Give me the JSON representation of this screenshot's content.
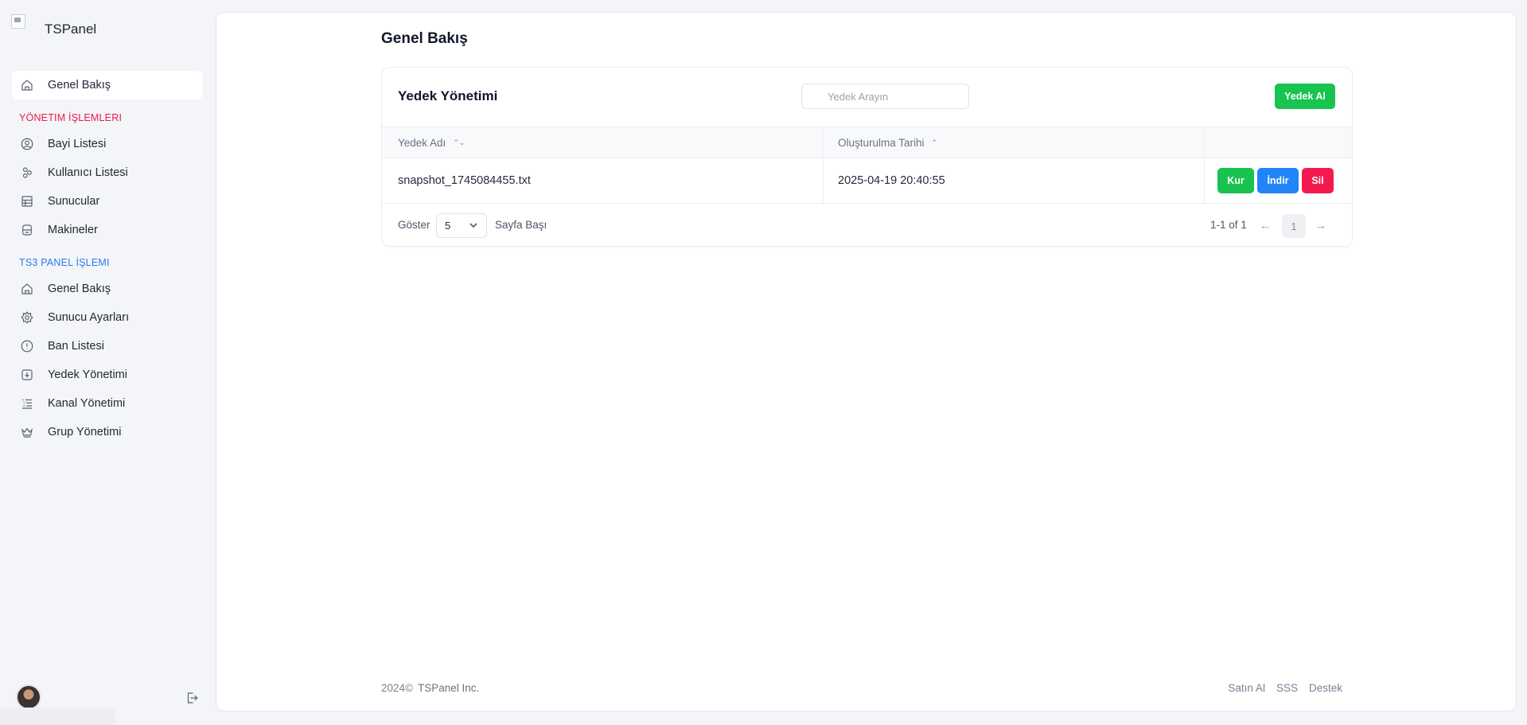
{
  "brand": {
    "name": "TSPanel"
  },
  "sidebar": {
    "top_items": [
      {
        "label": "Genel Bakış",
        "icon": "home-icon"
      }
    ],
    "section_admin": {
      "label": "YÖNETIM İŞLEMLERI",
      "items": [
        {
          "label": "Bayi Listesi",
          "icon": "user-circle-icon"
        },
        {
          "label": "Kullanıcı Listesi",
          "icon": "users-icon"
        },
        {
          "label": "Sunucular",
          "icon": "server-icon"
        },
        {
          "label": "Makineler",
          "icon": "machine-icon"
        }
      ]
    },
    "section_ts3": {
      "label": "TS3 PANEL İŞLEMI",
      "items": [
        {
          "label": "Genel Bakış",
          "icon": "home-icon"
        },
        {
          "label": "Sunucu Ayarları",
          "icon": "gear-icon"
        },
        {
          "label": "Ban Listesi",
          "icon": "ban-icon"
        },
        {
          "label": "Yedek Yönetimi",
          "icon": "backup-file-icon"
        },
        {
          "label": "Kanal Yönetimi",
          "icon": "list-icon"
        },
        {
          "label": "Grup Yönetimi",
          "icon": "crown-icon"
        }
      ]
    }
  },
  "page": {
    "title": "Genel Bakış"
  },
  "card": {
    "title": "Yedek Yönetimi",
    "search_placeholder": "Yedek Arayın",
    "backup_button": "Yedek Al"
  },
  "table": {
    "columns": [
      "Yedek Adı",
      "Oluşturulma Tarihi"
    ],
    "rows": [
      {
        "name": "snapshot_1745084455.txt",
        "date": "2025-04-19 20:40:55"
      }
    ],
    "actions": {
      "install": "Kur",
      "download": "İndir",
      "delete": "Sil"
    }
  },
  "pagination": {
    "show_label": "Göster",
    "page_size": "5",
    "per_page_label": "Sayfa Başı",
    "range": "1-1 of 1",
    "current_page": "1"
  },
  "footer": {
    "year": "2024©",
    "company": "TSPanel Inc.",
    "links": [
      "Satın Al",
      "SSS",
      "Destek"
    ]
  },
  "colors": {
    "accent_green": "#18c34f",
    "accent_blue": "#2185f8",
    "accent_red": "#f41a4f",
    "section_red": "#f0184f",
    "section_blue": "#2a7bef"
  }
}
